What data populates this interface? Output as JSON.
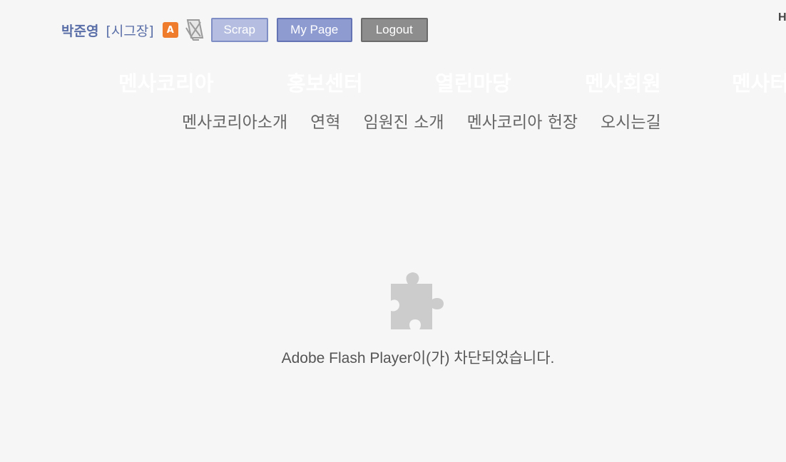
{
  "user": {
    "name": "박준영",
    "level": "[시그장]",
    "badge": "A"
  },
  "buttons": {
    "scrap": "Scrap",
    "mypage": "My Page",
    "logout": "Logout"
  },
  "corner_text": "H",
  "main_nav": [
    {
      "label": "멘사코리아"
    },
    {
      "label": "홍보센터"
    },
    {
      "label": "열린마당"
    },
    {
      "label": "멘사회원"
    },
    {
      "label": "멘사터"
    }
  ],
  "sub_nav": [
    {
      "label": "멘사코리아소개"
    },
    {
      "label": "연혁"
    },
    {
      "label": "임원진 소개"
    },
    {
      "label": "멘사코리아 헌장"
    },
    {
      "label": "오시는길"
    }
  ],
  "flash": {
    "message": "Adobe Flash Player이(가) 차단되었습니다.",
    "icon": "puzzle-piece-icon"
  },
  "colors": {
    "background": "#f6f6f6",
    "user_text": "#5a6fa8",
    "badge": "#ef7b2c",
    "plugin_icon": "#cccccc"
  }
}
